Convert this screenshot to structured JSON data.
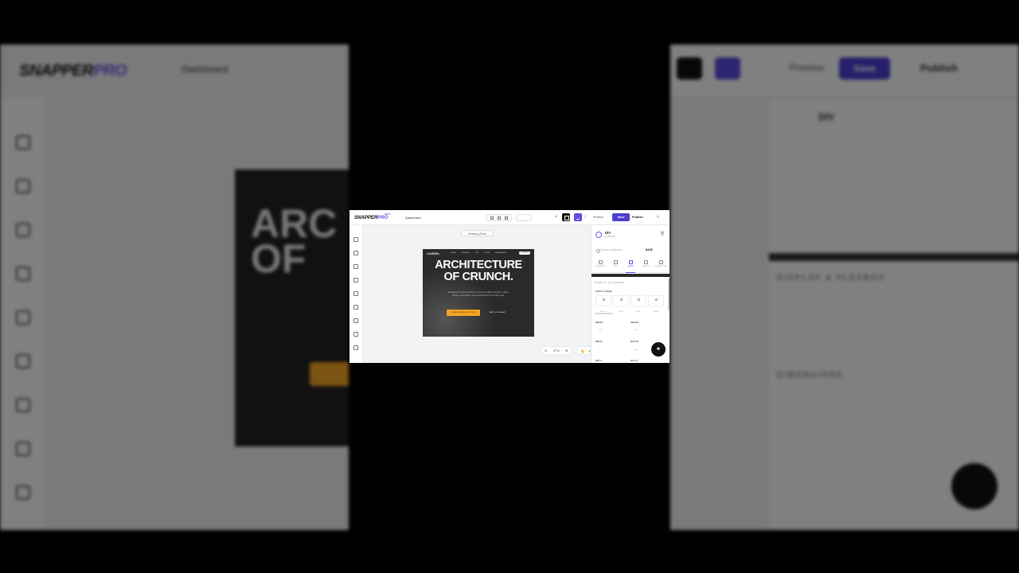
{
  "backdrop": {
    "logo_main": "SNAPPER",
    "logo_accent": "PRO",
    "nav_dashboard": "Dashboard",
    "canvas_heading": "ARC OF",
    "btn_preview": "Preview",
    "btn_save": "Save",
    "btn_publish": "Publish",
    "element_name": "DIV",
    "section_display": "DISPLAY & FLEXBOX",
    "section_dimensions": "DIMENSIONS"
  },
  "app": {
    "logo_main": "SNAPPER",
    "logo_accent": "PRO",
    "logo_badge": "BETA",
    "nav_dashboard": "Dashboard",
    "device_pill": "",
    "toolbar": {
      "undo": "↶",
      "preview": "Preview",
      "save": "Save",
      "publish": "Publish",
      "gear": "⚙",
      "moon": "☾"
    }
  },
  "canvas": {
    "viewport_chip": "Desktop (Flex)",
    "site": {
      "logo": "CARDEL",
      "nav_links": "SHOP  FLAVORS  OUR STORY  WHOLESALE",
      "nav_pill": "ORDER",
      "hero_title_line1": "ARCHITECTURE",
      "hero_title_line2": "OF CRUNCH.",
      "hero_sub": "Elevating the humble pretzel to a work of culinary structure. Hand-twisted, slow-baked, and engineered for the perfect snap.",
      "cta_primary": "EXPLORE THE COLLECTION",
      "cta_secondary": "WATCH THE CRAFT"
    },
    "zoom": {
      "minus": "⊖",
      "value": "47%",
      "plus": "⊕"
    },
    "tools": {
      "hand": "✋",
      "reset": "⟲"
    }
  },
  "panel": {
    "element_name": "DIV",
    "element_id": "id: 887c3d1",
    "trash": "🗑",
    "search_placeholder": "Search properties...",
    "size_select": "BASE",
    "tabs": [
      {
        "label": "TYPOGRAPHY"
      },
      {
        "label": "STYLE"
      },
      {
        "label": "LAYOUT"
      },
      {
        "label": "EFFECTS"
      },
      {
        "label": "INTERACTIONS"
      }
    ],
    "section_display": "DISPLAY & FLEXBOX",
    "display_mode_label": "DISPLAY MODE",
    "display_options": [
      "BLOCK",
      "FLEX",
      "GRID",
      "NONE"
    ],
    "section_dimensions": "DIMENSIONS",
    "width_label": "WIDTH",
    "height_label": "HEIGHT",
    "width_val": "auto",
    "height_val": "auto",
    "min_w_label": "MIN W",
    "max_w_label": "MAX W",
    "min_w_val": "0",
    "max_w_val": "none",
    "min_h_label": "MIN H",
    "max_h_label": "MAX H",
    "sparkle": "✦"
  }
}
